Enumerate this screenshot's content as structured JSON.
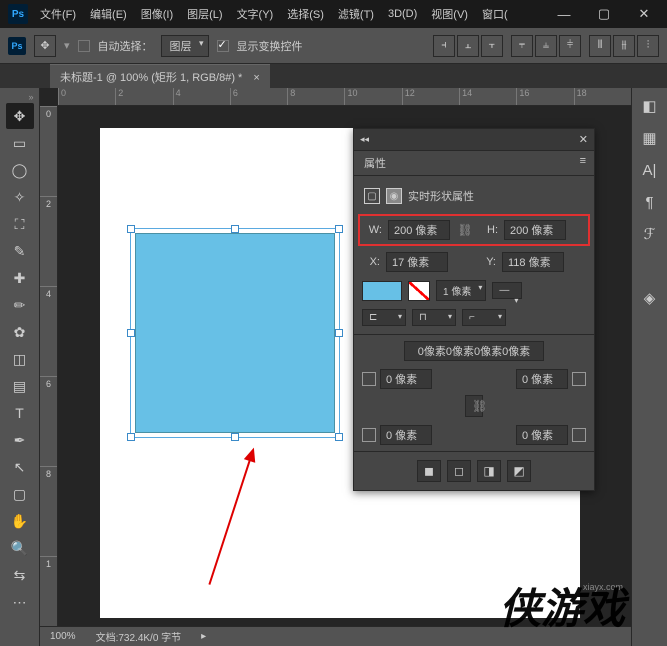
{
  "app": {
    "logo": "Ps"
  },
  "menu": {
    "file": "文件(F)",
    "edit": "编辑(E)",
    "image": "图像(I)",
    "layer": "图层(L)",
    "type": "文字(Y)",
    "select": "选择(S)",
    "filter": "滤镜(T)",
    "threeD": "3D(D)",
    "view": "视图(V)",
    "window": "窗口("
  },
  "options": {
    "auto_select_label": "自动选择：",
    "auto_select_target": "图层",
    "show_transform": "显示变换控件"
  },
  "document": {
    "tab_title": "未标题-1 @ 100% (矩形 1, RGB/8#) *",
    "zoom": "100%",
    "info": "文档:732.4K/0 字节"
  },
  "properties": {
    "panel_title": "属性",
    "sub_title": "实时形状属性",
    "w_label": "W:",
    "w_value": "200 像素",
    "h_label": "H:",
    "h_value": "200 像素",
    "x_label": "X:",
    "x_value": "17 像素",
    "y_label": "Y:",
    "y_value": "118 像素",
    "stroke_width": "1 像素",
    "corners_summary": "0像素0像素0像素0像素",
    "corner_value": "0 像素",
    "link_glyph": "⛓"
  },
  "ruler": {
    "h": [
      "0",
      "2",
      "4",
      "6",
      "8",
      "10",
      "12",
      "14",
      "16",
      "18"
    ],
    "v": [
      "0",
      "2",
      "4",
      "6",
      "8",
      "1"
    ]
  },
  "icons": {
    "move": "✥",
    "marquee": "▭",
    "lasso": "◯",
    "wand": "✧",
    "crop": "⛶",
    "eyedropper": "✎",
    "heal": "✚",
    "brush": "✏",
    "stamp": "✿",
    "eraser": "◫",
    "gradient": "▤",
    "type": "T",
    "pen": "✒",
    "path": "↖",
    "shape": "▢",
    "hand": "✋",
    "zoom": "🔍",
    "swap": "⇆",
    "dots": "⋯",
    "color": "◧",
    "swatches": "▦",
    "char": "A|",
    "para": "¶",
    "brushes": "ℱ",
    "layers": "◈"
  },
  "watermark": {
    "text": "侠游戏",
    "url": "xiayx.com"
  }
}
